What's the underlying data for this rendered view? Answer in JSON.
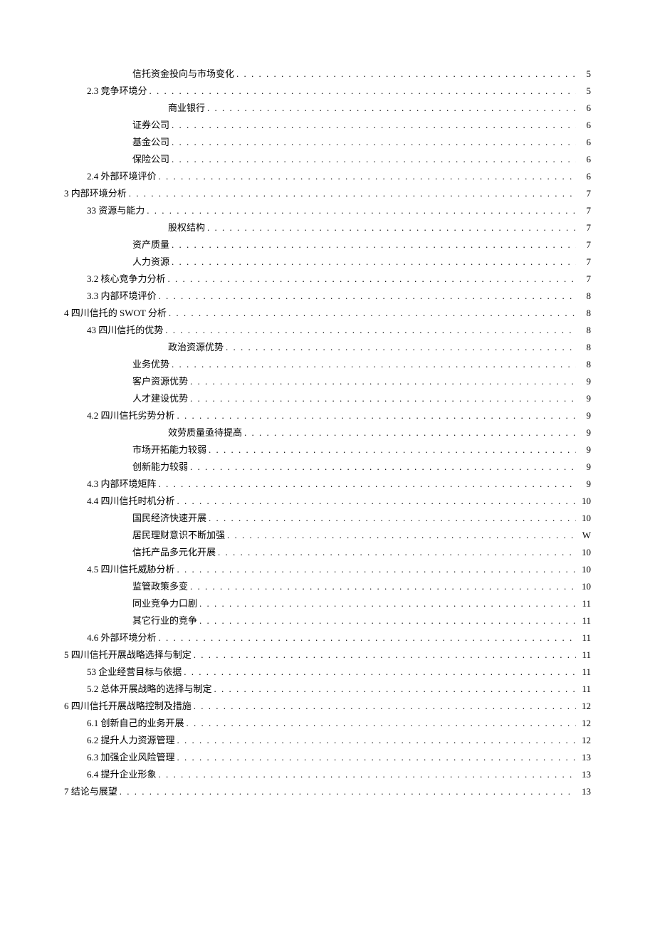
{
  "toc": [
    {
      "level": "lv3",
      "label": "信托资金投向与市场变化",
      "page": "5"
    },
    {
      "level": "lv2",
      "label": "2.3 竞争环境分",
      "page": "5"
    },
    {
      "level": "lv3b",
      "label": "商业银行",
      "page": "6"
    },
    {
      "level": "lv3",
      "label": "证券公司",
      "page": "6"
    },
    {
      "level": "lv3",
      "label": "基金公司",
      "page": "6"
    },
    {
      "level": "lv3",
      "label": "保险公司",
      "page": "6"
    },
    {
      "level": "lv2",
      "label": "2.4 外部环境评价",
      "page": "6"
    },
    {
      "level": "lv1",
      "label": "3 内部环境分析",
      "page": "7"
    },
    {
      "level": "lv2",
      "label": "33 资源与能力",
      "page": "7"
    },
    {
      "level": "lv3b",
      "label": "股权结构",
      "page": "7"
    },
    {
      "level": "lv3",
      "label": "资产质量",
      "page": "7"
    },
    {
      "level": "lv3",
      "label": "人力资源",
      "page": "7"
    },
    {
      "level": "lv2",
      "label": "3.2 核心竞争力分析",
      "page": "7"
    },
    {
      "level": "lv2",
      "label": "3.3 内部环境评价",
      "page": "8"
    },
    {
      "level": "lv1",
      "label": "4 四川信托的 SWOT 分析",
      "page": "8"
    },
    {
      "level": "lv2",
      "label": "43 四川信托的优势",
      "page": "8"
    },
    {
      "level": "lv3b",
      "label": "政治资源优势",
      "page": "8"
    },
    {
      "level": "lv3",
      "label": "业务优势",
      "page": "8"
    },
    {
      "level": "lv3",
      "label": "客户资源优势",
      "page": "9"
    },
    {
      "level": "lv3",
      "label": "人才建设优势",
      "page": "9"
    },
    {
      "level": "lv2",
      "label": "4.2 四川信托劣势分析",
      "page": "9"
    },
    {
      "level": "lv3b",
      "label": "效劳质量亟待提高",
      "page": "9"
    },
    {
      "level": "lv3",
      "label": "市场开拓能力较弱",
      "page": "9"
    },
    {
      "level": "lv3",
      "label": "创新能力较弱",
      "page": "9"
    },
    {
      "level": "lv2",
      "label": "4.3 内部环境矩阵",
      "page": "9"
    },
    {
      "level": "lv2",
      "label": "4.4 四川信托时机分析",
      "page": "10"
    },
    {
      "level": "lv3",
      "label": "国民经济快速开展",
      "page": "10"
    },
    {
      "level": "lv3",
      "label": "居民理财意识不断加强",
      "page": "W"
    },
    {
      "level": "lv3",
      "label": "信托产品多元化开展",
      "page": "10"
    },
    {
      "level": "lv2",
      "label": "4.5 四川信托威胁分析",
      "page": "10"
    },
    {
      "level": "lv3",
      "label": "监管政策多变",
      "page": "10"
    },
    {
      "level": "lv3",
      "label": "同业竞争力口剧",
      "page": "11"
    },
    {
      "level": "lv3",
      "label": "其它行业的竞争",
      "page": "11"
    },
    {
      "level": "lv2",
      "label": "4.6 外部环境分析",
      "page": "11"
    },
    {
      "level": "lv1",
      "label": "5 四川信托开展战略选择与制定",
      "page": "11"
    },
    {
      "level": "lv2",
      "label": "53 企业经营目标与依据",
      "page": "11"
    },
    {
      "level": "lv2",
      "label": "5.2 总体开展战略的选择与制定",
      "page": "11"
    },
    {
      "level": "lv1",
      "label": "6 四川信托开展战略控制及措施",
      "page": "12"
    },
    {
      "level": "lv2",
      "label": "6.1 创新自己的业务开展",
      "page": "12"
    },
    {
      "level": "lv2",
      "label": "6.2 提升人力资源管理",
      "page": "12"
    },
    {
      "level": "lv2",
      "label": "6.3 加强企业风险管理",
      "page": "13"
    },
    {
      "level": "lv2",
      "label": "6.4 提升企业形象",
      "page": "13"
    },
    {
      "level": "lv1",
      "label": "7 结论与展望",
      "page": "13"
    }
  ]
}
